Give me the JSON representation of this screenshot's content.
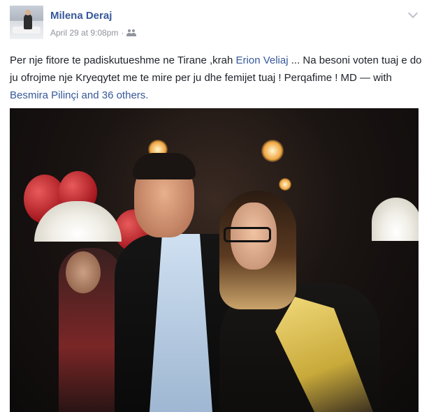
{
  "post": {
    "author": "Milena Deraj",
    "date": "April 29 at 9:08pm",
    "separator": "·",
    "audience_icon": "friends-icon",
    "options_icon": "chevron-down-icon",
    "text_part1": "Per nje fitore te padiskutueshme ne Tirane ,krah ",
    "tag1": "Erion Veliaj",
    "text_part2": " ... Na besoni voten tuaj e do ju ofrojme nje Kryeqytet me te mire per ju dhe femijet tuaj ! Perqafime ! MD — with ",
    "tag2": "Besmira Pilinçi",
    "text_and": " and ",
    "tag3": "36 others",
    "text_end": "."
  },
  "colors": {
    "link": "#365899",
    "text": "#1d2129",
    "meta": "#90949c"
  }
}
